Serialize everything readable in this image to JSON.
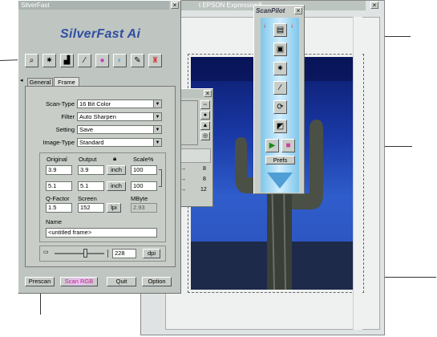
{
  "background_window": {
    "title": "t EPSON Expression8..."
  },
  "silverfast": {
    "title": "SilverFast",
    "logo": "SilverFast Ai",
    "toolbar_icons": [
      "magnifier-icon",
      "flash-icon",
      "histogram-icon",
      "gradation-icon",
      "color-icon",
      "selective-color-icon",
      "edit-icon",
      "expert-icon"
    ],
    "tabs": [
      "General",
      "Frame"
    ],
    "fields": {
      "scan_type": {
        "label": "Scan-Type",
        "value": "16 Bit Color"
      },
      "filter": {
        "label": "Filter",
        "value": "Auto Sharpen"
      },
      "setting": {
        "label": "Setting",
        "value": "Save"
      },
      "image_type": {
        "label": "Image-Type",
        "value": "Standard"
      }
    },
    "dimensions": {
      "original_label": "Original",
      "output_label": "Output",
      "scale_label": "Scale%",
      "original_w": "3.9",
      "original_h": "5.1",
      "output_w": "3.9",
      "output_h": "5.1",
      "unit": "inch",
      "scale_w": "100",
      "scale_h": "100"
    },
    "qfactor": {
      "qfactor_label": "Q-Factor",
      "screen_label": "Screen",
      "mbyte_label": "MByte",
      "qfactor_value": "1.5",
      "screen_value": "152",
      "screen_unit": "lpi",
      "mbyte_value": "2.93"
    },
    "name": {
      "label": "Name",
      "value": "<untitled frame>"
    },
    "resolution": {
      "value": "228",
      "unit": "dpi"
    },
    "bottom_buttons": {
      "prescan": "Prescan",
      "scan": "Scan RGB",
      "quit": "Quit",
      "option": "Option"
    }
  },
  "densitometer": {
    "values": [
      "8",
      "8",
      "12"
    ]
  },
  "scanpilot": {
    "title": "ScanPilot",
    "prefs": "Prefs"
  }
}
